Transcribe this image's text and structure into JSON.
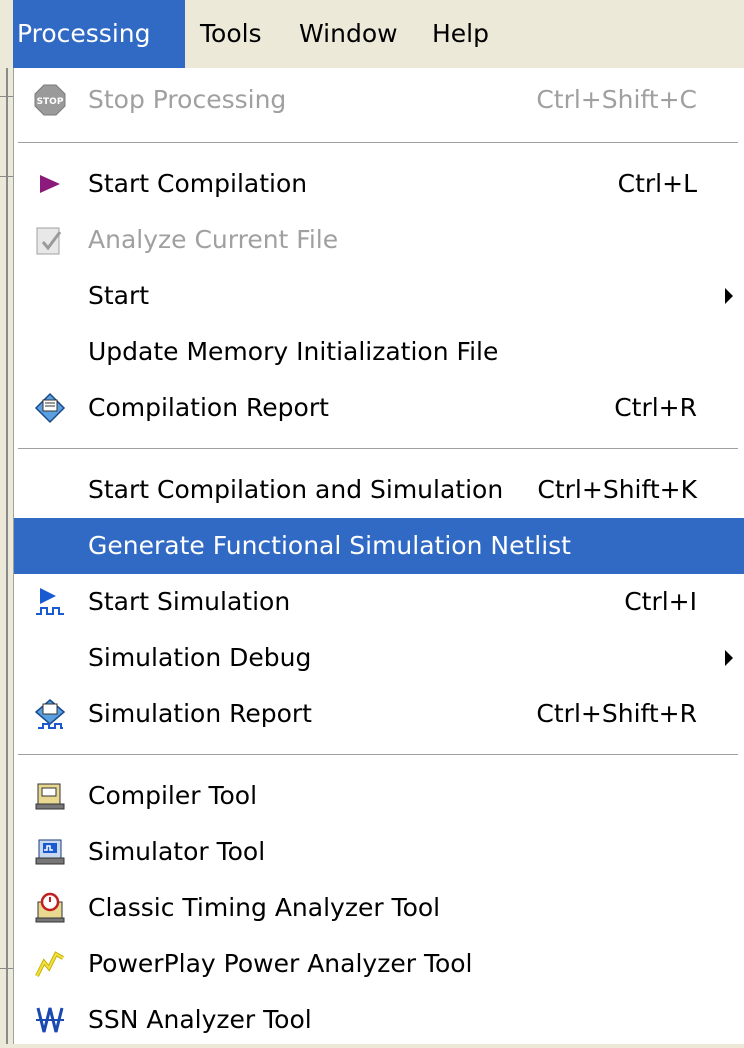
{
  "menubar": {
    "items": [
      {
        "label": "Processing",
        "active": true
      },
      {
        "label": "Tools"
      },
      {
        "label": "Window"
      },
      {
        "label": "Help"
      }
    ]
  },
  "menu": {
    "items": [
      {
        "label": "Stop Processing",
        "shortcut": "Ctrl+Shift+C",
        "icon": "stop-icon",
        "disabled": true
      },
      {
        "label": "Start Compilation",
        "shortcut": "Ctrl+L",
        "icon": "play-triangle-icon"
      },
      {
        "label": "Analyze Current File",
        "icon": "analyze-file-icon",
        "disabled": true
      },
      {
        "label": "Start",
        "submenu": true
      },
      {
        "label": "Update Memory Initialization File"
      },
      {
        "label": "Compilation Report",
        "shortcut": "Ctrl+R",
        "icon": "compilation-report-icon"
      },
      {
        "label": "Start Compilation and Simulation",
        "shortcut": "Ctrl+Shift+K"
      },
      {
        "label": "Generate Functional Simulation Netlist",
        "highlighted": true
      },
      {
        "label": "Start Simulation",
        "shortcut": "Ctrl+I",
        "icon": "start-simulation-icon"
      },
      {
        "label": "Simulation Debug",
        "submenu": true
      },
      {
        "label": "Simulation Report",
        "shortcut": "Ctrl+Shift+R",
        "icon": "simulation-report-icon"
      },
      {
        "label": "Compiler Tool",
        "icon": "compiler-tool-icon"
      },
      {
        "label": "Simulator Tool",
        "icon": "simulator-tool-icon"
      },
      {
        "label": "Classic Timing Analyzer Tool",
        "icon": "timing-analyzer-icon"
      },
      {
        "label": "PowerPlay Power Analyzer Tool",
        "icon": "power-analyzer-icon"
      },
      {
        "label": "SSN Analyzer Tool",
        "icon": "ssn-analyzer-icon"
      }
    ]
  }
}
